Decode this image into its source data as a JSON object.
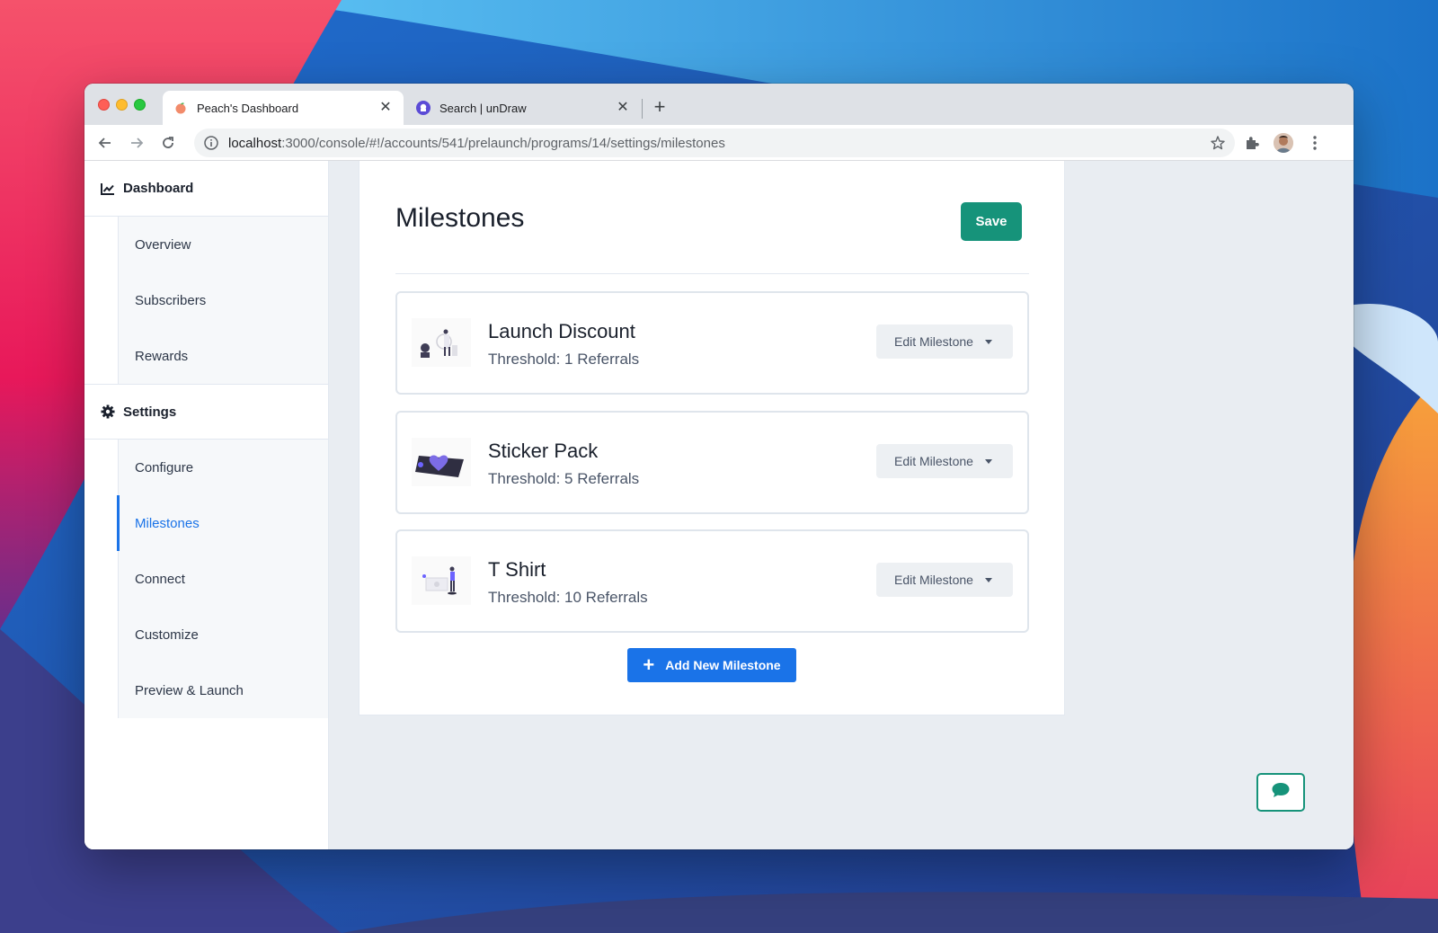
{
  "browser": {
    "tabs": [
      {
        "title": "Peach's Dashboard",
        "active": true,
        "favicon": "peach-icon"
      },
      {
        "title": "Search | unDraw",
        "active": false,
        "favicon": "undraw-icon"
      }
    ],
    "url_host": "localhost",
    "url_rest": ":3000/console/#!/accounts/541/prelaunch/programs/14/settings/milestones"
  },
  "sidebar": {
    "dashboard_label": "Dashboard",
    "dashboard_items": [
      {
        "label": "Overview"
      },
      {
        "label": "Subscribers"
      },
      {
        "label": "Rewards"
      }
    ],
    "settings_label": "Settings",
    "settings_items": [
      {
        "label": "Configure",
        "active": false
      },
      {
        "label": "Milestones",
        "active": true
      },
      {
        "label": "Connect",
        "active": false
      },
      {
        "label": "Customize",
        "active": false
      },
      {
        "label": "Preview & Launch",
        "active": false
      }
    ]
  },
  "main": {
    "title": "Milestones",
    "save_label": "Save",
    "milestones": [
      {
        "name": "Launch Discount",
        "threshold": "Threshold: 1 Referrals",
        "edit_label": "Edit Milestone"
      },
      {
        "name": "Sticker Pack",
        "threshold": "Threshold: 5 Referrals",
        "edit_label": "Edit Milestone"
      },
      {
        "name": "T Shirt",
        "threshold": "Threshold: 10 Referrals",
        "edit_label": "Edit Milestone"
      }
    ],
    "add_label": "Add New Milestone"
  },
  "colors": {
    "primary_blue": "#1a73e8",
    "save_green": "#16937a"
  }
}
